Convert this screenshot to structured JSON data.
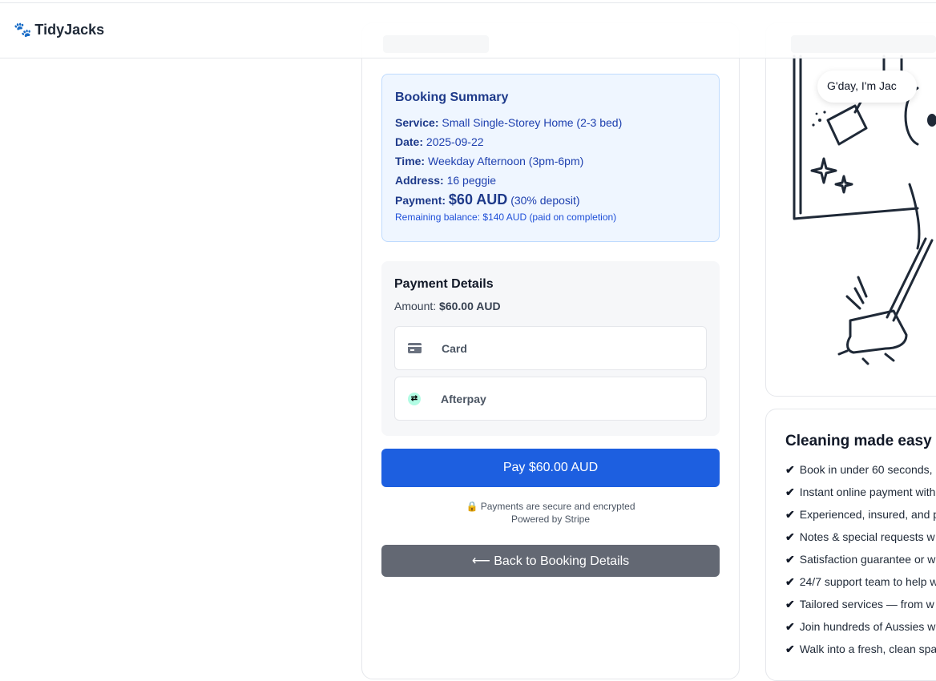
{
  "header": {
    "brand": "TidyJacks",
    "brand_icon": "paw-prints-icon"
  },
  "summary": {
    "title": "Booking Summary",
    "service_label": "Service:",
    "service_value": "Small Single-Storey Home (2-3 bed)",
    "date_label": "Date:",
    "date_value": "2025-09-22",
    "time_label": "Time:",
    "time_value": "Weekday Afternoon (3pm-6pm)",
    "address_label": "Address:",
    "address_value": "16 peggie",
    "payment_label": "Payment:",
    "payment_amount": "$60 AUD",
    "payment_note": "(30% deposit)",
    "remaining": "Remaining balance: $140 AUD (paid on completion)"
  },
  "payment": {
    "title": "Payment Details",
    "amount_label": "Amount:",
    "amount_value": "$60.00 AUD",
    "methods": [
      {
        "label": "Card",
        "icon": "credit-card-icon"
      },
      {
        "label": "Afterpay",
        "icon": "afterpay-icon"
      }
    ],
    "pay_button": "Pay $60.00 AUD",
    "secure_text": "Payments are secure and encrypted",
    "powered_by": "Powered by Stripe",
    "back_button": "⟵ Back to Booking Details"
  },
  "mascot": {
    "speech": "G'day, I'm Jac"
  },
  "marketing": {
    "title": "Cleaning made easy",
    "features": [
      "Book in under 60 seconds,",
      "Instant online payment with",
      "Experienced, insured, and p",
      "Notes & special requests w",
      "Satisfaction guarantee or w",
      "24/7 support team to help w",
      "Tailored services — from w",
      "Join hundreds of Aussies w",
      "Walk into a fresh, clean spa"
    ]
  },
  "colors": {
    "primary": "#1d5fe0",
    "secondary": "#636873",
    "summary_bg": "#eff6ff",
    "summary_text": "#1e3a8a"
  }
}
